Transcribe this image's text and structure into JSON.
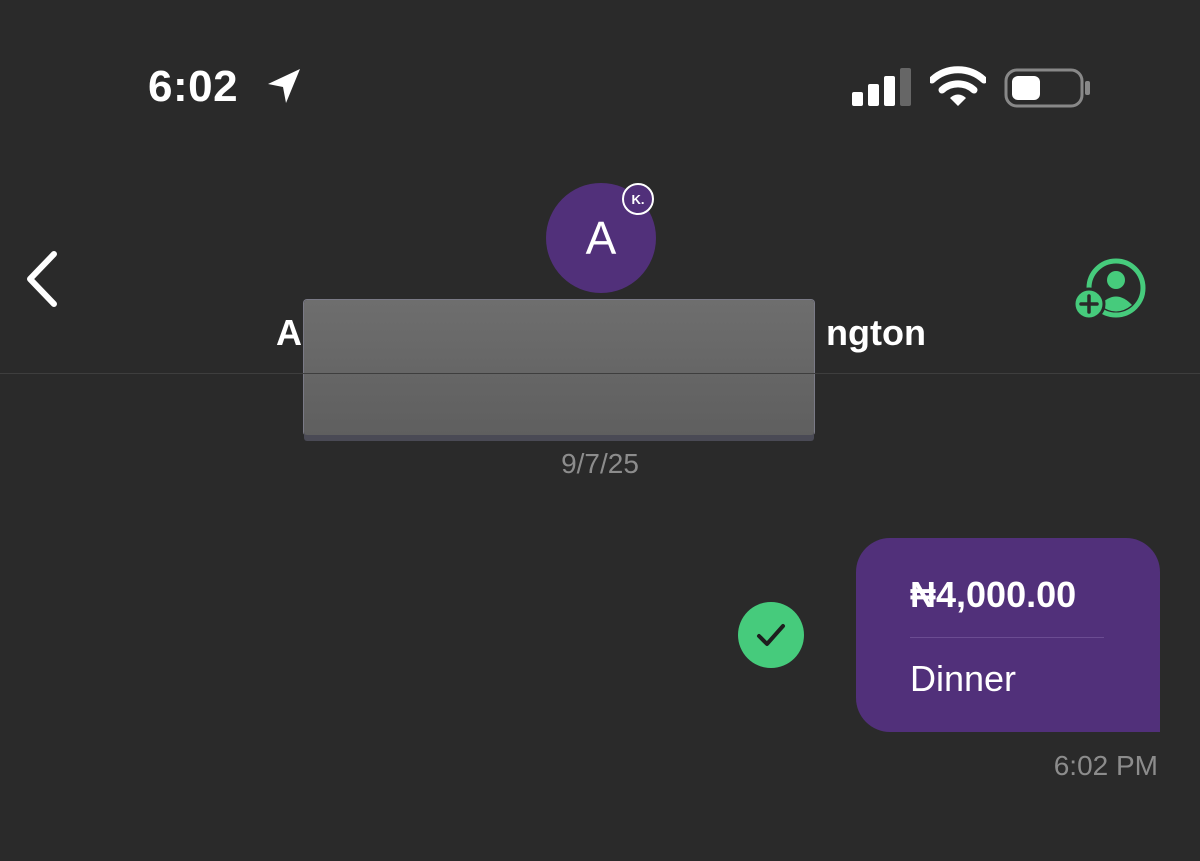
{
  "status_bar": {
    "time": "6:02",
    "location_icon": "location-arrow-icon",
    "signal_icon": "cellular-signal-icon",
    "wifi_icon": "wifi-icon",
    "battery_icon": "battery-icon",
    "battery_level": 0.35
  },
  "header": {
    "back_icon": "chevron-left-icon",
    "avatar_letter": "A",
    "badge_text": "K.",
    "name_start": "A",
    "name_end": "ngton",
    "add_user_icon": "add-user-icon"
  },
  "chat": {
    "date": "9/7/25",
    "status_icon": "checkmark-icon",
    "amount": "₦4,000.00",
    "note": "Dinner",
    "time": "6:02 PM"
  },
  "colors": {
    "background": "#2a2a2a",
    "accent_purple": "#51307a",
    "success_green": "#46cb7c",
    "muted_text": "#8c8c8c"
  }
}
